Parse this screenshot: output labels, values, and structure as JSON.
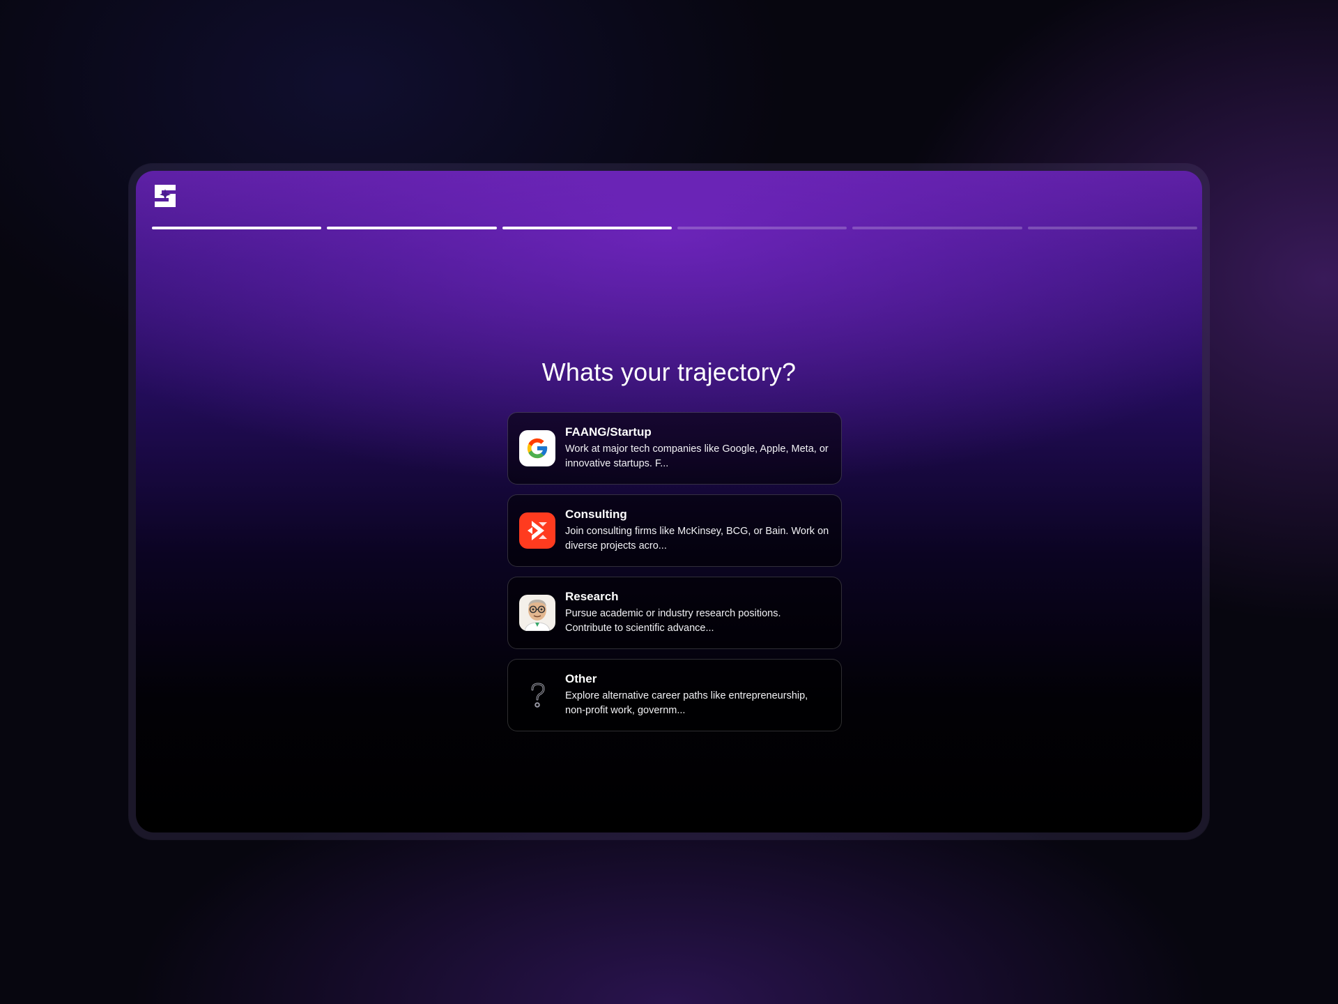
{
  "app": {
    "logo_icon": "s-star-logo-icon"
  },
  "progress": {
    "total_steps": 6,
    "completed_steps": 3
  },
  "page": {
    "title": "Whats your trajectory?"
  },
  "options": [
    {
      "label": "FAANG/Startup",
      "description": "Work at major tech companies like Google, Apple, Meta, or innovative startups. F...",
      "icon": "google-icon"
    },
    {
      "label": "Consulting",
      "description": "Join consulting firms like McKinsey, BCG, or Bain. Work on diverse projects acro...",
      "icon": "consulting-icon"
    },
    {
      "label": "Research",
      "description": "Pursue academic or industry research positions. Contribute to scientific advance...",
      "icon": "scientist-icon"
    },
    {
      "label": "Other",
      "description": "Explore alternative career paths like entrepreneurship, non-profit work, governm...",
      "icon": "question-mark-icon"
    }
  ],
  "colors": {
    "accent_purple": "#5a1fa0",
    "consulting_red": "#ff3b1f",
    "progress_done": "#ffffff"
  }
}
